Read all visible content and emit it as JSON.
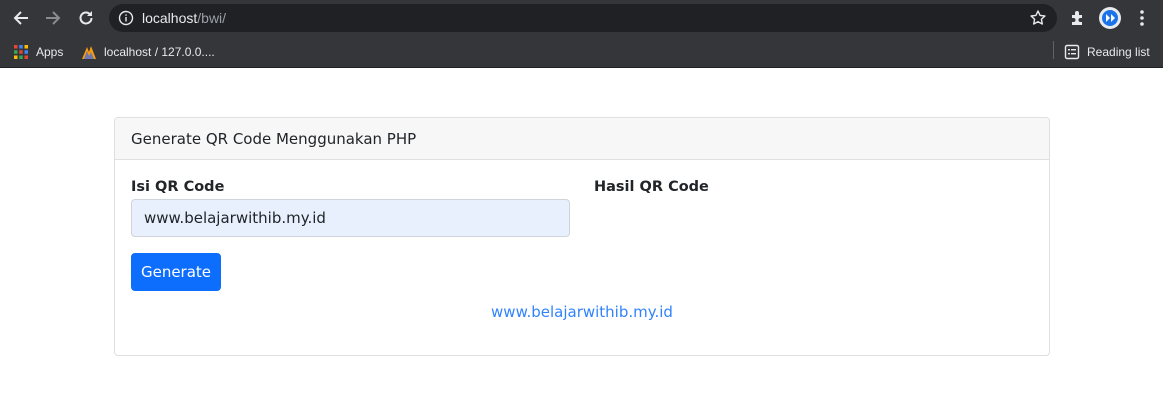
{
  "browser": {
    "url_host": "localhost",
    "url_path": "/bwi/",
    "bookmarks": [
      {
        "label": "Apps",
        "icon": "apps-grid-icon"
      },
      {
        "label": "localhost / 127.0.0....",
        "icon": "phpmyadmin-icon"
      }
    ],
    "reading_list_label": "Reading list"
  },
  "page": {
    "card_title": "Generate QR Code Menggunakan PHP",
    "input_label": "Isi QR Code",
    "input_value": "www.belajarwithib.my.id",
    "result_label": "Hasil QR Code",
    "generate_label": "Generate",
    "site_link": "www.belajarwithib.my.id"
  },
  "colors": {
    "primary": "#0d6efd",
    "input_autofill_bg": "#e8f0fe",
    "chrome_toolbar": "#35363a",
    "omnibox_bg": "#202124"
  }
}
